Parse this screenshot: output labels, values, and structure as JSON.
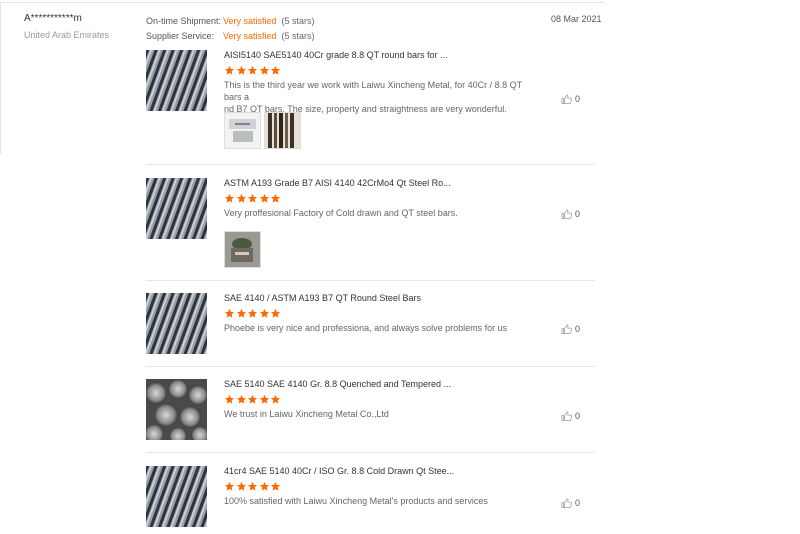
{
  "reviewer": {
    "name": "A***********m",
    "country": "United Arab Emirates"
  },
  "ratings": [
    {
      "label": "On-time Shipment:",
      "value": "Very satisfied",
      "count": "(5 stars)"
    },
    {
      "label": "Supplier Service:",
      "value": "Very satisfied",
      "count": "(5 stars)"
    }
  ],
  "date": "08 Mar 2021",
  "colors": {
    "accent": "#ff6a00",
    "star": "#ff6a00"
  },
  "items": [
    {
      "title": "AISI5140 SAE5140 40Cr grade 8.8 QT round bars for ...",
      "stars": 5,
      "comment_line1": "This is the third year we work with Laiwu Xincheng Metal, for 40Cr / 8.8 QT bars a",
      "comment_line2": "nd B7 QT bars. The size, property and straightness are very wonderful.",
      "likes": "0",
      "photos": 2
    },
    {
      "title": "ASTM A193 Grade B7 AISI 4140 42CrMo4 Qt Steel Ro...",
      "stars": 5,
      "comment_line1": "Very proffesional Factory of Cold drawn and QT steel bars.",
      "likes": "0",
      "photos": 1
    },
    {
      "title": "SAE 4140 / ASTM A193 B7 QT Round Steel Bars",
      "stars": 5,
      "comment_line1": "Phoebe is very nice and professiona, and always solve problems for us",
      "likes": "0",
      "photos": 0
    },
    {
      "title": "SAE 5140 SAE 4140 Gr. 8.8 Quenched and Tempered ...",
      "stars": 5,
      "comment_line1": "We trust in Laiwu Xincheng Metal Co.,Ltd",
      "likes": "0",
      "photos": 0
    },
    {
      "title": "41cr4 SAE 5140 40Cr / ISO Gr. 8.8 Cold Drawn Qt Stee...",
      "stars": 5,
      "comment_line1": "100% satisfied with Laiwu Xincheng Metal's products and services",
      "likes": "0",
      "photos": 0
    }
  ]
}
